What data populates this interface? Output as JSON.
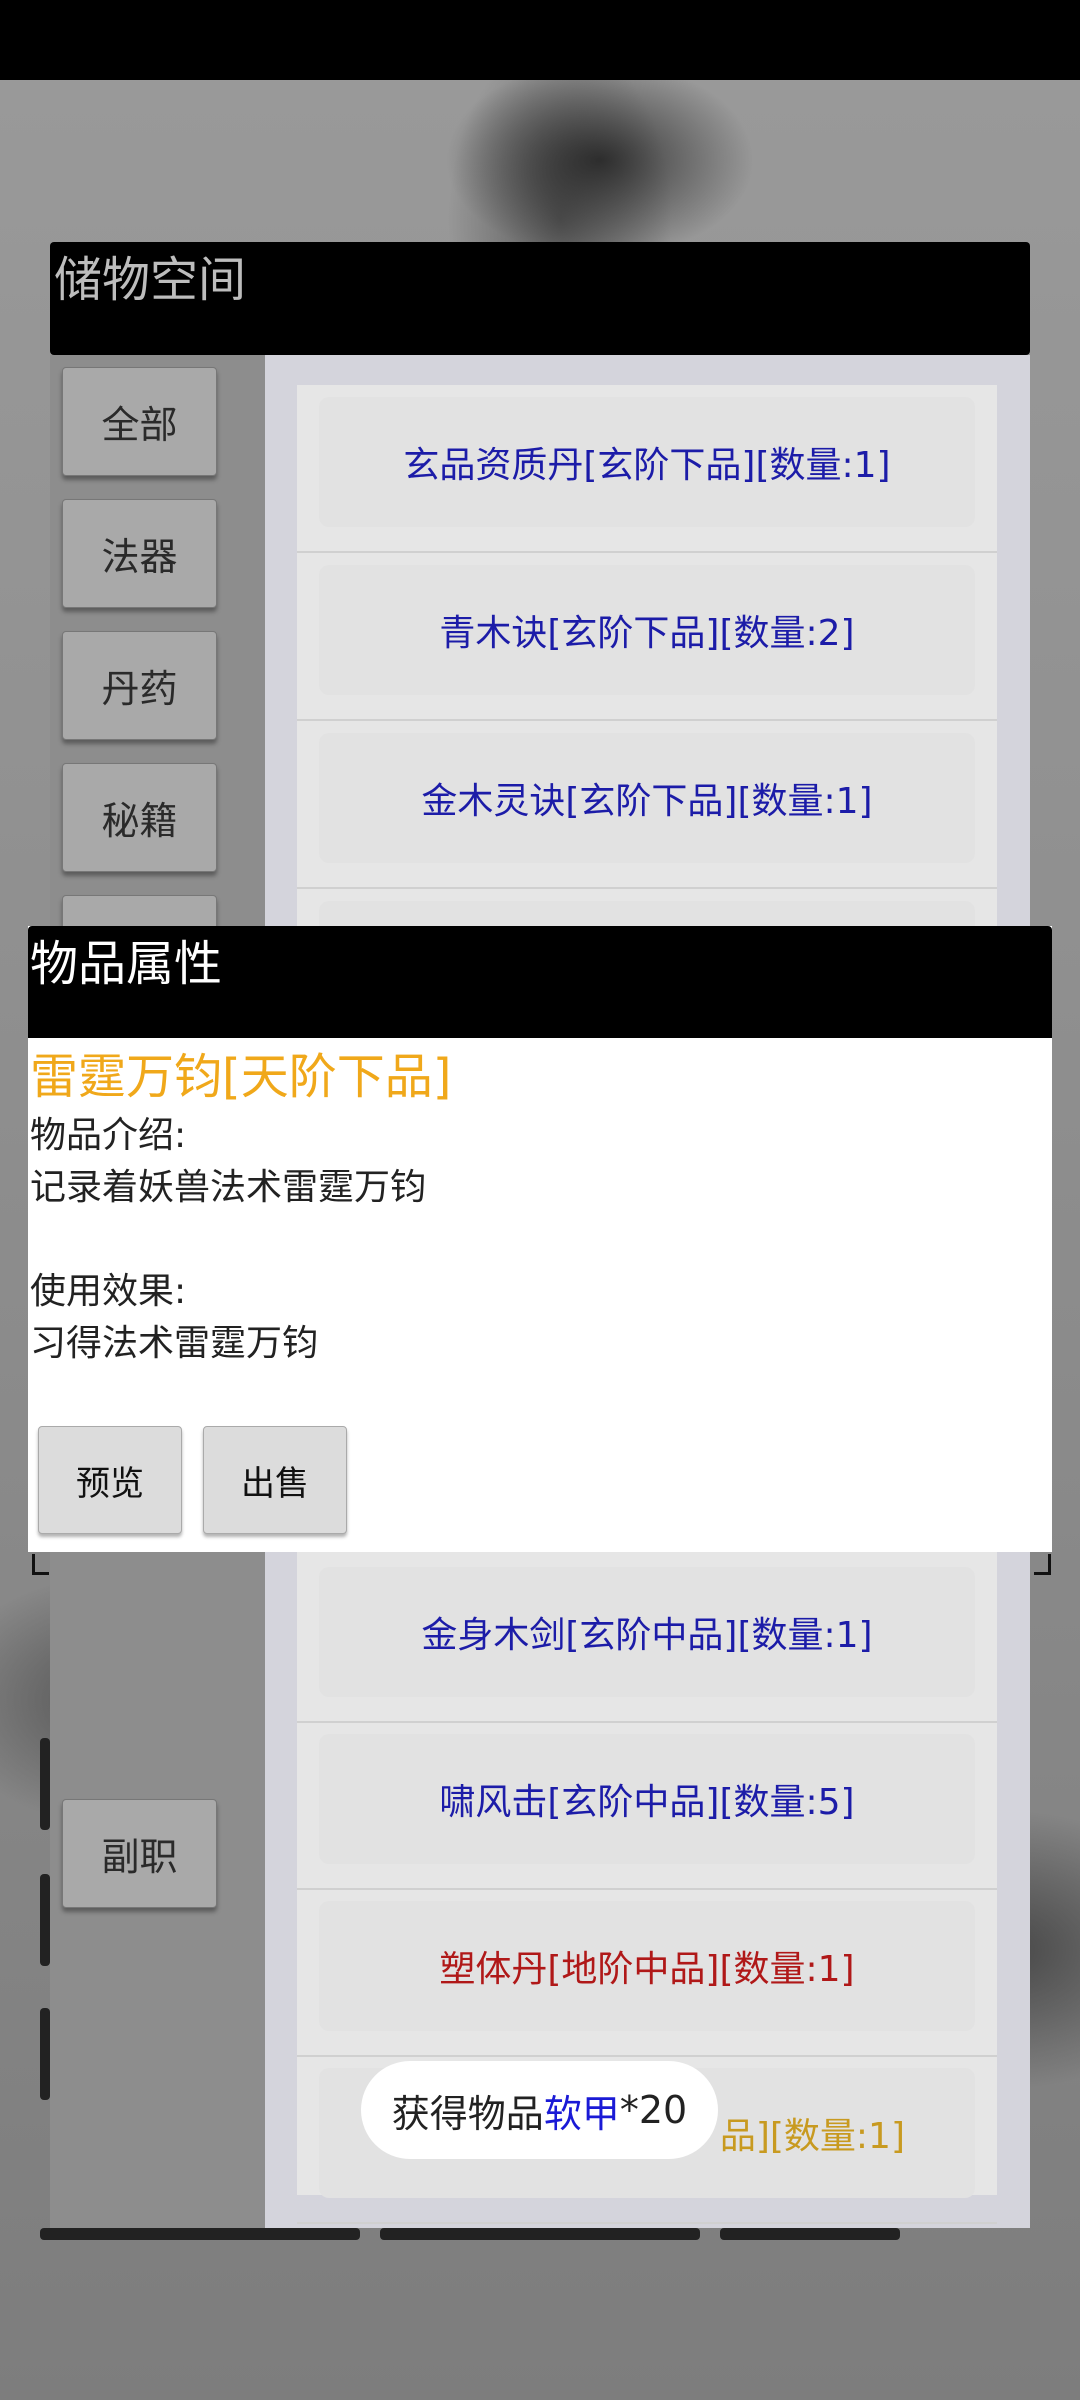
{
  "storage": {
    "title": "储物空间",
    "categories": [
      {
        "label": "全部"
      },
      {
        "label": "法器"
      },
      {
        "label": "丹药"
      },
      {
        "label": "秘籍"
      },
      {
        "label": "副职"
      }
    ],
    "items": [
      {
        "label": "玄品资质丹[玄阶下品][数量:1]",
        "color": "#1c1ca8"
      },
      {
        "label": "青木诀[玄阶下品][数量:2]",
        "color": "#1c1ca8"
      },
      {
        "label": "金木灵诀[玄阶下品][数量:1]",
        "color": "#1c1ca8"
      },
      {
        "label": "金身木剑[玄阶中品][数量:1]",
        "color": "#1c1ca8"
      },
      {
        "label": "啸风击[玄阶中品][数量:5]",
        "color": "#1c1ca8"
      },
      {
        "label": "塑体丹[地阶中品][数量:1]",
        "color": "#b01818"
      },
      {
        "label": "品][数量:1]",
        "color": "#c89a20"
      }
    ]
  },
  "modal": {
    "title": "物品属性",
    "item_name": "雷霆万钧[天阶下品]",
    "intro_label": "物品介绍:",
    "intro_text": "记录着妖兽法术雷霆万钧",
    "effect_label": "使用效果:",
    "effect_text": "习得法术雷霆万钧",
    "buttons": {
      "preview": "预览",
      "sell": "出售"
    }
  },
  "toast": {
    "prefix": "获得物品",
    "item": "软甲",
    "suffix": "*20"
  },
  "colors": {
    "item_name": "#f0a81a",
    "xuan_tier": "#1c1ca8",
    "di_tier": "#b01818"
  }
}
